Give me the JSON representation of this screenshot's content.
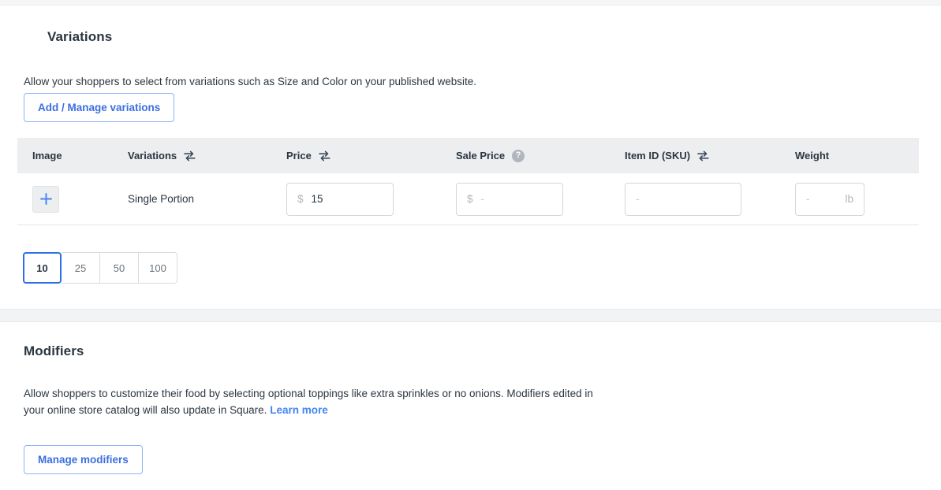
{
  "variations": {
    "title": "Variations",
    "description": "Allow your shoppers to select from variations such as Size and Color on your published website.",
    "add_button": "Add / Manage variations",
    "columns": {
      "image": "Image",
      "variations": "Variations",
      "price": "Price",
      "sale_price": "Sale Price",
      "sku": "Item ID (SKU)",
      "weight": "Weight"
    },
    "icons": {
      "swap": "swap-icon",
      "help": "?",
      "add_image": "plus-icon"
    },
    "rows": [
      {
        "name": "Single Portion",
        "price": {
          "prefix": "$",
          "value": "15",
          "placeholder": ""
        },
        "sale_price": {
          "prefix": "$",
          "value": "",
          "placeholder": "-"
        },
        "sku": {
          "value": "",
          "placeholder": "-"
        },
        "weight": {
          "value": "",
          "placeholder": "-",
          "suffix": "lb"
        }
      }
    ],
    "page_sizes": [
      "10",
      "25",
      "50",
      "100"
    ],
    "page_size_selected": "10"
  },
  "modifiers": {
    "title": "Modifiers",
    "description": "Allow shoppers to customize their food by selecting optional toppings like extra sprinkles or no onions. Modifiers edited in your online store catalog will also update in Square.",
    "learn_more": "Learn more",
    "manage_button": "Manage modifiers"
  },
  "colors": {
    "accent_blue": "#4285f4",
    "link_blue": "#3b6fe0",
    "text_dark": "#2b3641",
    "table_header_bg": "#eceef0",
    "divider": "#e4e6e8"
  }
}
